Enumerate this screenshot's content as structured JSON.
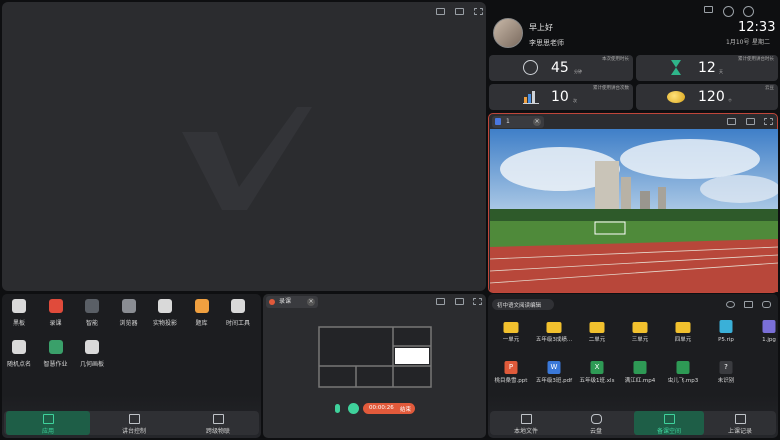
{
  "greeting": "早上好",
  "teacher_name": "李思思老师",
  "clock": {
    "time": "12:33",
    "date": "1月10号",
    "weekday": "星期二"
  },
  "stats": [
    {
      "value": "45",
      "unit": "分钟",
      "label": "本次使用时长"
    },
    {
      "value": "12",
      "unit": "天",
      "label": "累计使用讲台时长"
    },
    {
      "value": "10",
      "unit": "次",
      "label": "累计使用讲台次数"
    },
    {
      "value": "120",
      "unit": "个",
      "label": "云豆"
    }
  ],
  "viewer_tab": {
    "title": "1"
  },
  "apps": [
    {
      "label": "黑板",
      "color": "#d9d9d9"
    },
    {
      "label": "录课",
      "color": "#e04b3b"
    },
    {
      "label": "智能",
      "color": "#5a5f66"
    },
    {
      "label": "浏览器",
      "color": "#8a8d93"
    },
    {
      "label": "实物投影",
      "color": "#d9d9d9"
    },
    {
      "label": "题库",
      "color": "#f0a040"
    },
    {
      "label": "时间工具",
      "color": "#d9d9d9"
    },
    {
      "label": "随机点名",
      "color": "#d9d9d9"
    },
    {
      "label": "智慧作业",
      "color": "#3aa06a"
    },
    {
      "label": "几何画板",
      "color": "#d9d9d9"
    }
  ],
  "left_nav": [
    {
      "label": "应用",
      "active": true
    },
    {
      "label": "讲台控制",
      "active": false
    },
    {
      "label": "跨级物联",
      "active": false
    }
  ],
  "recorder": {
    "title": "录课",
    "timer": "00:00:26",
    "end_label": "结束"
  },
  "files_header": {
    "folder": "初中语文阅读编辑"
  },
  "files": [
    {
      "name": "一单元",
      "type": "folder",
      "color": "#f2c12e"
    },
    {
      "name": "五年级3成绩...",
      "type": "folder",
      "color": "#f2c12e"
    },
    {
      "name": "二单元",
      "type": "folder",
      "color": "#f2c12e"
    },
    {
      "name": "三单元",
      "type": "folder",
      "color": "#f2c12e"
    },
    {
      "name": "四单元",
      "type": "folder",
      "color": "#f2c12e"
    },
    {
      "name": "P5.rip",
      "type": "archive",
      "color": "#3ab0d8"
    },
    {
      "name": "1.jpg",
      "type": "image",
      "color": "#7a6fd8"
    },
    {
      "name": "桃目桑雪.ppt",
      "type": "ppt",
      "color": "#e05a3a",
      "glyph": "P"
    },
    {
      "name": "五年级3班.pdf",
      "type": "word",
      "color": "#3a78d8",
      "glyph": "W"
    },
    {
      "name": "五年级1班.xls",
      "type": "excel",
      "color": "#2e9a55",
      "glyph": "X"
    },
    {
      "name": "满江红.mp4",
      "type": "video",
      "color": "#2e9a55"
    },
    {
      "name": "虫儿飞.mp3",
      "type": "audio",
      "color": "#2e9a55"
    },
    {
      "name": "未识别",
      "type": "unknown",
      "color": "#3a3b3f",
      "glyph": "?"
    }
  ],
  "right_nav": [
    {
      "label": "本地文件",
      "active": false
    },
    {
      "label": "云盘",
      "active": false
    },
    {
      "label": "备课空间",
      "active": true
    },
    {
      "label": "上课记录",
      "active": false
    }
  ],
  "colors": {
    "accent": "#1e7f5c",
    "record": "#e25a3b"
  }
}
